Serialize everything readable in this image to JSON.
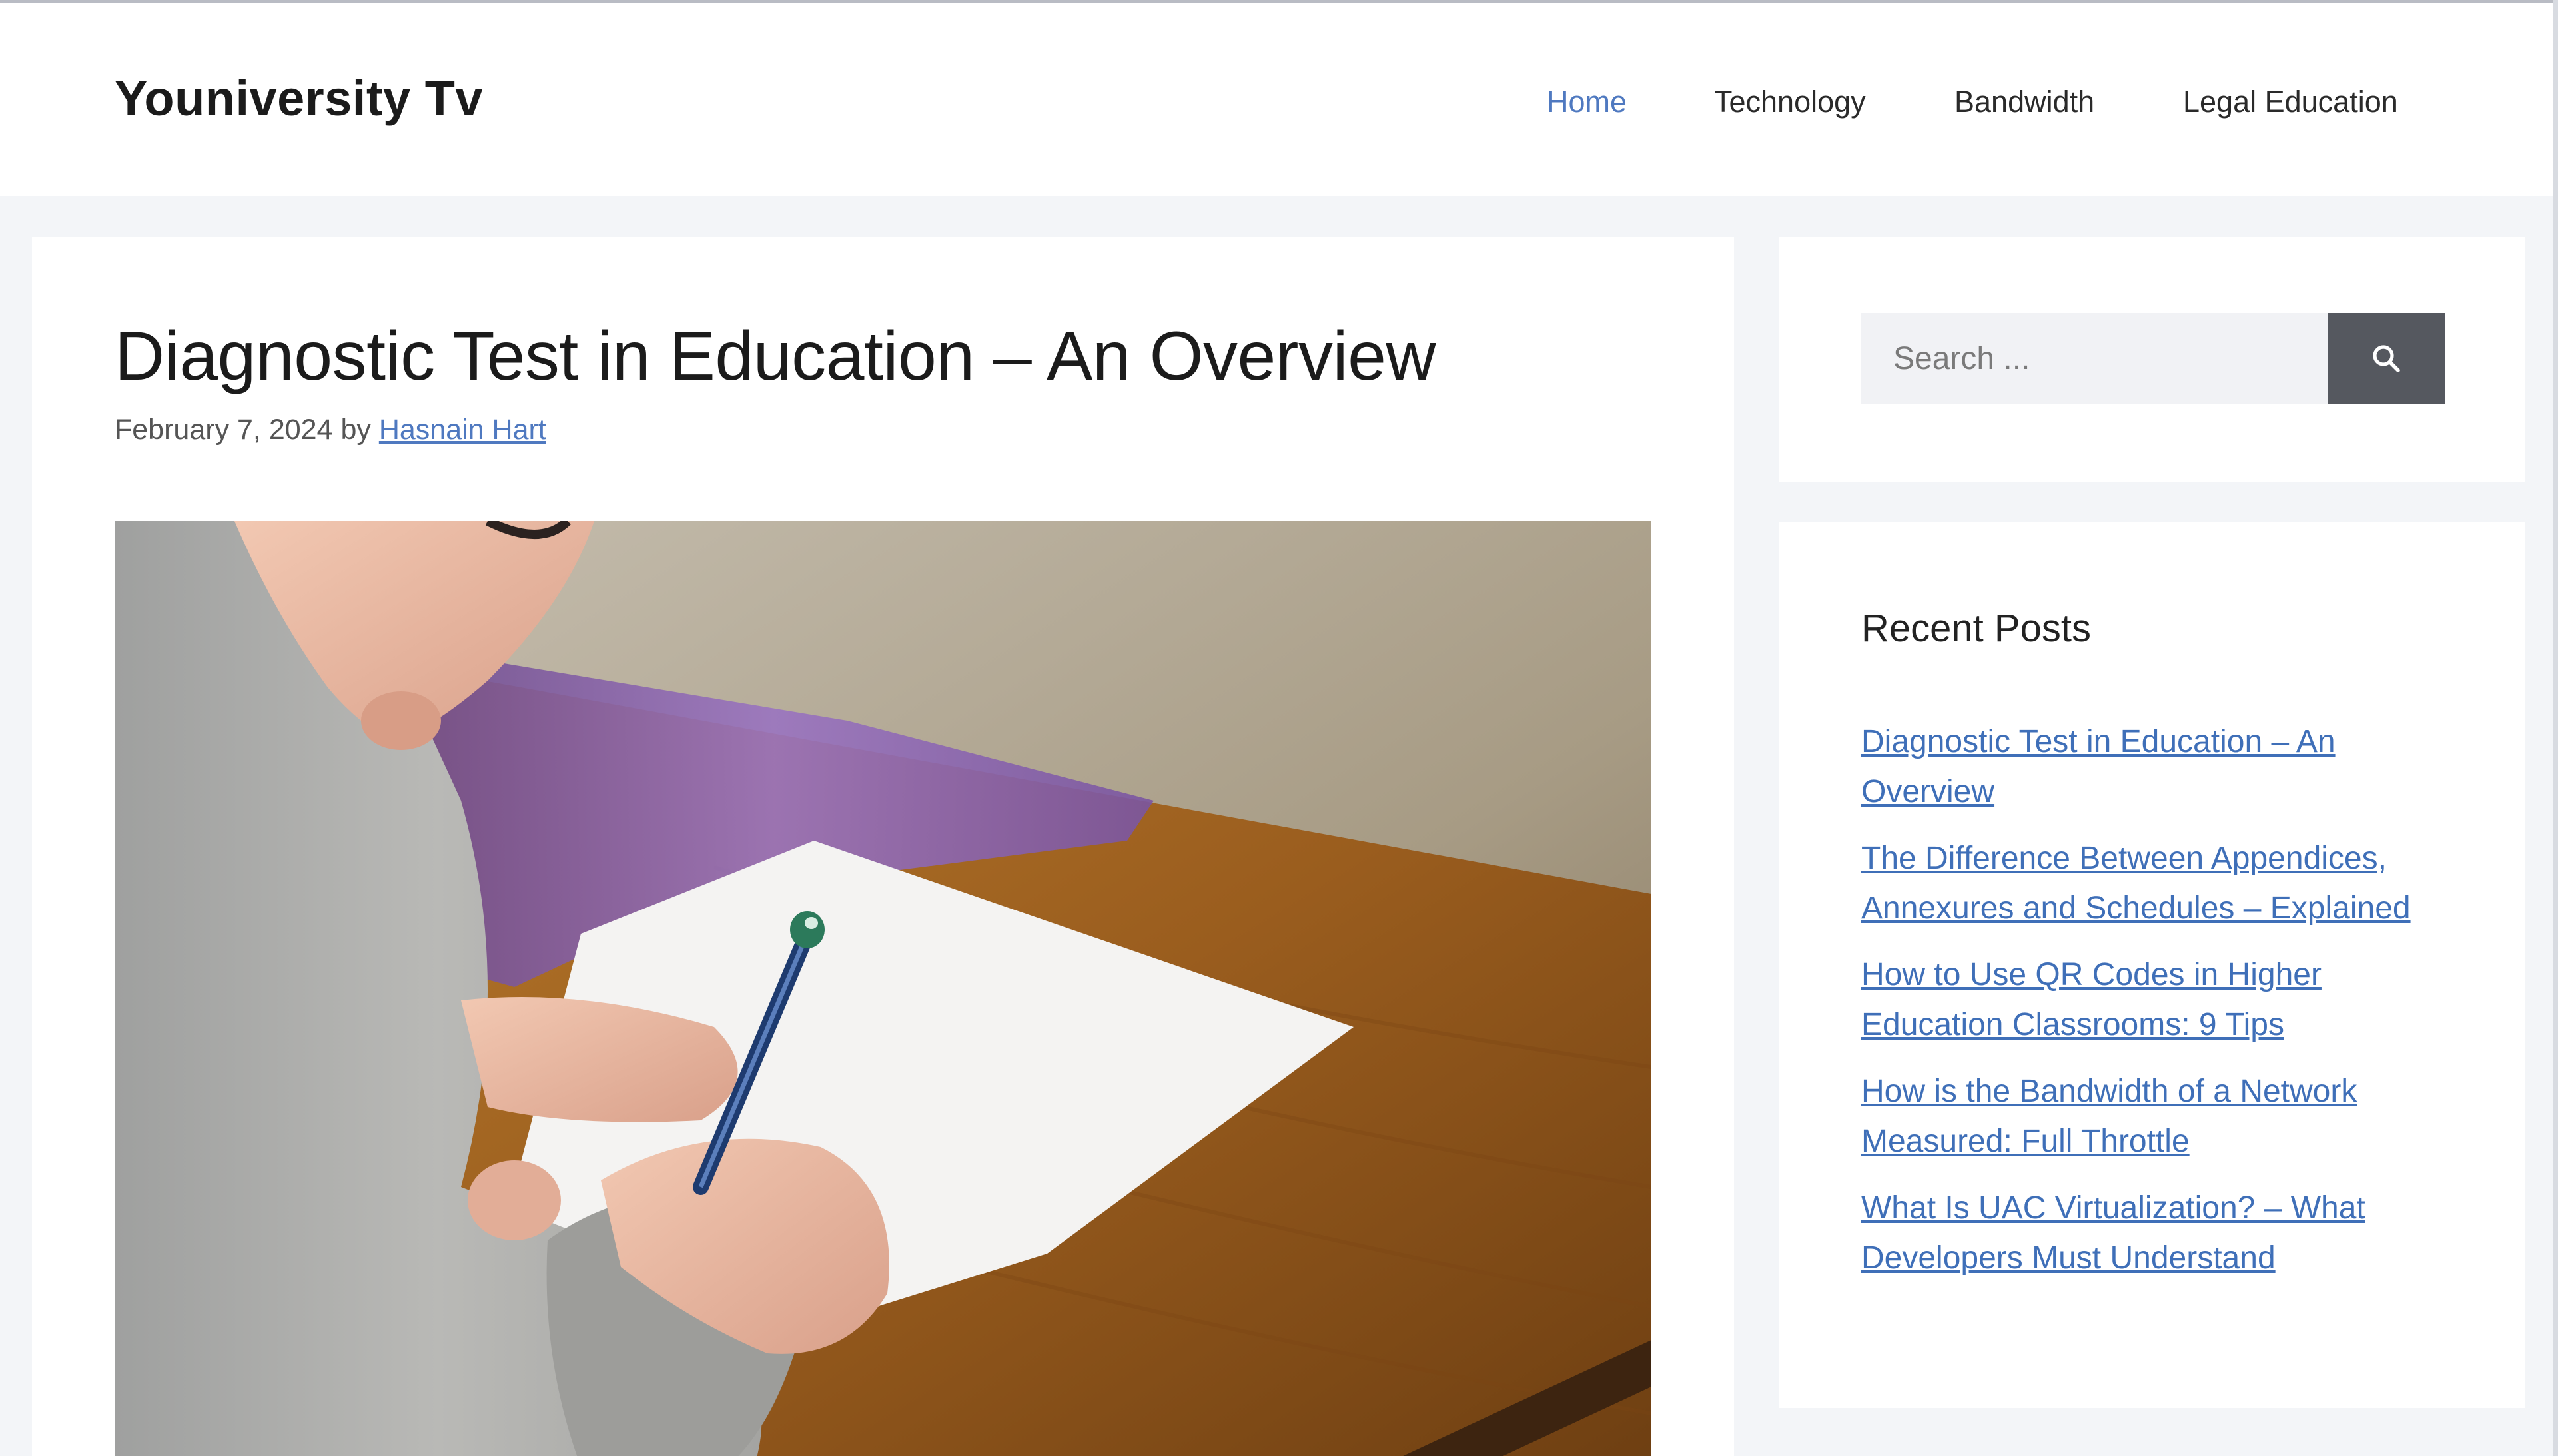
{
  "site": {
    "title": "Youniversity Tv"
  },
  "nav": {
    "items": [
      {
        "label": "Home",
        "active": true
      },
      {
        "label": "Technology",
        "active": false
      },
      {
        "label": "Bandwidth",
        "active": false
      },
      {
        "label": "Legal Education",
        "active": false
      }
    ]
  },
  "article": {
    "title": "Diagnostic Test in Education – An Overview",
    "date": "February 7, 2024",
    "by": "by",
    "author": "Hasnain Hart"
  },
  "search": {
    "placeholder": "Search ...",
    "icon": "search-icon"
  },
  "recent_posts": {
    "title": "Recent Posts",
    "items": [
      "Diagnostic Test in Education – An Overview",
      "The Difference Between Appendices, Annexures and Schedules – Explained",
      "How to Use QR Codes in Higher Education Classrooms: 9 Tips",
      "How is the Bandwidth of a Network Measured: Full Throttle",
      "What Is UAC Virtualization? – What Developers Must Understand"
    ]
  },
  "colors": {
    "accent": "#4f79c0",
    "link": "#3f6fb8",
    "page_background": "#f3f5f8",
    "search_button": "#55585f"
  }
}
